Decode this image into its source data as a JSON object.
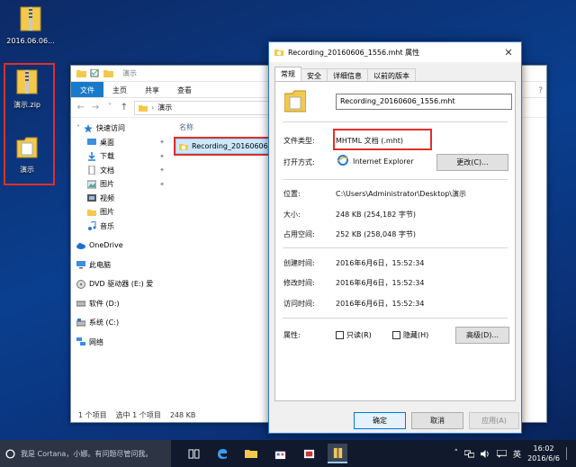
{
  "desktop": {
    "icons": [
      {
        "label": "2016.06.06..."
      },
      {
        "label": "演示.zip"
      },
      {
        "label": "演示"
      }
    ]
  },
  "explorer": {
    "title": "演示",
    "ribbon_tabs": [
      "文件",
      "主页",
      "共享",
      "查看"
    ],
    "address_path": "演示",
    "nav_items": [
      {
        "label": "快速访问"
      },
      {
        "label": "桌面"
      },
      {
        "label": "下载"
      },
      {
        "label": "文档"
      },
      {
        "label": "图片"
      },
      {
        "label": "视频"
      },
      {
        "label": "图片"
      },
      {
        "label": "音乐"
      },
      {
        "label": "OneDrive"
      },
      {
        "label": "此电脑"
      },
      {
        "label": "DVD 驱动器 (E:) 爱"
      },
      {
        "label": "软件 (D:)"
      },
      {
        "label": "系统 (C:)"
      },
      {
        "label": "网络"
      }
    ],
    "column_name": "名称",
    "file_name": "Recording_20160606_1",
    "status": {
      "count": "1 个项目",
      "selected": "选中 1 个项目",
      "size": "248 KB"
    }
  },
  "dialog": {
    "title": "Recording_20160606_1556.mht 属性",
    "close_glyph": "✕",
    "tabs": [
      "常规",
      "安全",
      "详细信息",
      "以前的版本"
    ],
    "file_name": "Recording_20160606_1556.mht",
    "props": {
      "type_label": "文件类型:",
      "type_value": "MHTML 文档 (.mht)",
      "open_label": "打开方式:",
      "open_value": "Internet Explorer",
      "change_button": "更改(C)...",
      "location_label": "位置:",
      "location_value": "C:\\Users\\Administrator\\Desktop\\演示",
      "size_label": "大小:",
      "size_value": "248 KB (254,182 字节)",
      "disk_label": "占用空间:",
      "disk_value": "252 KB (258,048 字节)",
      "created_label": "创建时间:",
      "created_value": "2016年6月6日，15:52:34",
      "modified_label": "修改时间:",
      "modified_value": "2016年6月6日，15:52:34",
      "accessed_label": "访问时间:",
      "accessed_value": "2016年6月6日，15:52:34",
      "attr_label": "属性:",
      "readonly_label": "只读(R)",
      "hidden_label": "隐藏(H)",
      "advanced_button": "高级(D)..."
    },
    "buttons": {
      "ok": "确定",
      "cancel": "取消",
      "apply": "应用(A)"
    }
  },
  "taskbar": {
    "cortana_text": "我是 Cortana，小娜。有问题尽管问我。",
    "ime": "英",
    "time": "16:02",
    "date": "2016/6/6"
  },
  "colors": {
    "highlight_red": "#e0302a",
    "ribbon_blue": "#1979ca",
    "selection": "#cce8ff"
  }
}
